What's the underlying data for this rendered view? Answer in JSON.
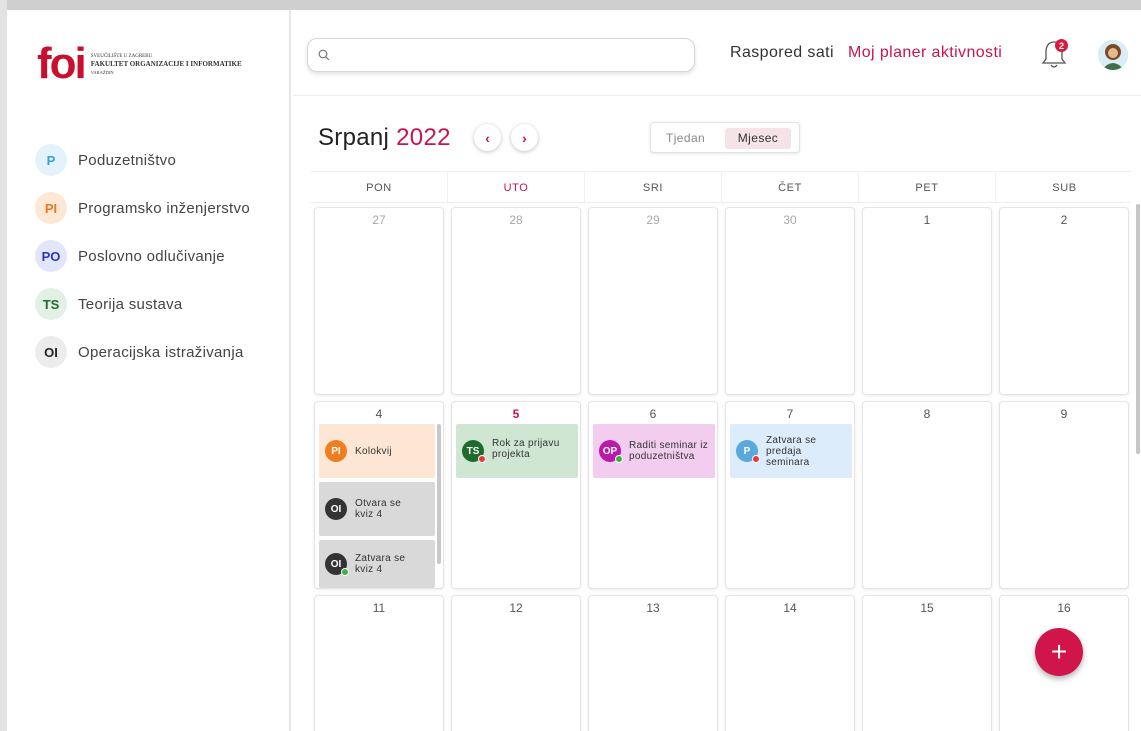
{
  "logo": {
    "mark": "foi",
    "line1": "SVEUČILIŠTE U ZAGREBU",
    "line2": "FAKULTET ORGANIZACIJE I INFORMATIKE",
    "line3": "VARAŽDIN"
  },
  "sidebar": {
    "courses": [
      {
        "code": "P",
        "label": "Poduzetništvo",
        "bg": "#e3f2fb",
        "fg": "#3aa0d8"
      },
      {
        "code": "PI",
        "label": "Programsko inženjerstvo",
        "bg": "#fde8d6",
        "fg": "#e8781e"
      },
      {
        "code": "PO",
        "label": "Poslovno odlučivanje",
        "bg": "#e3e6fb",
        "fg": "#2a35c8"
      },
      {
        "code": "TS",
        "label": "Teorija sustava",
        "bg": "#e2f1e4",
        "fg": "#1e6b2c"
      },
      {
        "code": "OI",
        "label": "Operacijska istraživanja",
        "bg": "#ececec",
        "fg": "#222222"
      }
    ]
  },
  "header": {
    "search_placeholder": "",
    "nav_raspored": "Raspored sati",
    "nav_planer": "Moj planer aktivnosti",
    "notification_count": "2",
    "accent": "#c8154f"
  },
  "calendar": {
    "month": "Srpanj",
    "year": "2022",
    "prev": "‹",
    "next": "›",
    "view_week": "Tjedan",
    "view_month": "Mjesec",
    "days": [
      "PON",
      "UTO",
      "SRI",
      "ČET",
      "PET",
      "SUB"
    ],
    "rows": [
      [
        "27",
        "28",
        "29",
        "30",
        "1",
        "2"
      ],
      [
        "4",
        "5",
        "6",
        "7",
        "8",
        "9"
      ],
      [
        "11",
        "12",
        "13",
        "14",
        "15",
        "16"
      ]
    ],
    "events": {
      "kolokvij": {
        "badge": "PI",
        "text": "Kolokvij"
      },
      "otvara": {
        "badge": "OI",
        "text": "Otvara se kviz 4"
      },
      "zatvara_kviz": {
        "badge": "OI",
        "text": "Zatvara se kviz 4"
      },
      "rok": {
        "badge": "TS",
        "text": "Rok za prijavu projekta"
      },
      "raditi": {
        "badge": "OP",
        "text": "Raditi seminar iz poduzetništva"
      },
      "zatvara_sem": {
        "badge": "P",
        "text": "Zatvara se predaja seminara"
      }
    },
    "add": "+"
  }
}
